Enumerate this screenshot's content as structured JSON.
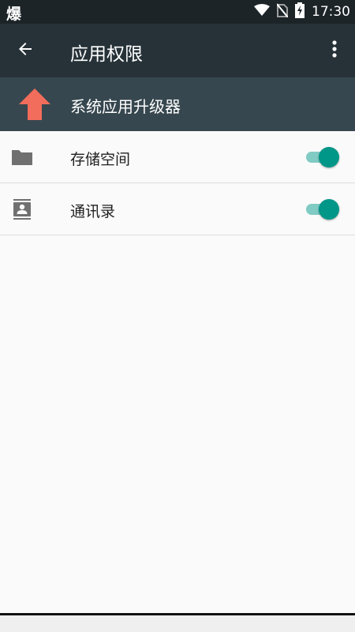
{
  "status_bar": {
    "left_glyph": "爆",
    "time": "17:30",
    "icons": [
      "wifi-icon",
      "no-sim-icon",
      "battery-charging-icon"
    ]
  },
  "app_bar": {
    "title": "应用权限",
    "back_icon": "arrow-left-icon",
    "more_icon": "more-vert-icon"
  },
  "app_header": {
    "app_name": "系统应用升级器",
    "app_icon": "arrow-up-icon",
    "app_icon_color": "#f26d5b"
  },
  "permissions": [
    {
      "label": "存储空间",
      "icon": "folder-icon",
      "enabled": true
    },
    {
      "label": "通讯录",
      "icon": "contacts-icon",
      "enabled": true
    }
  ],
  "colors": {
    "status_bar": "#1c2428",
    "app_bar": "#263238",
    "app_header": "#37474f",
    "toggle_thumb_on": "#009688",
    "toggle_track_on": "#80cbc4"
  }
}
